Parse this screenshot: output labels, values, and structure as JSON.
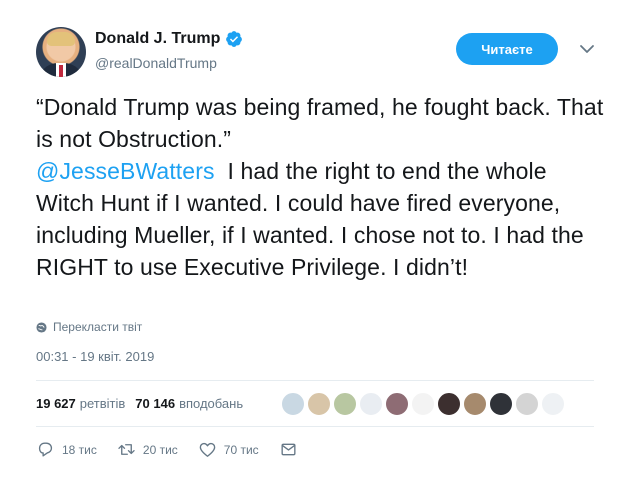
{
  "author": {
    "name": "Donald J. Trump",
    "handle": "@realDonaldTrump",
    "verified": true
  },
  "follow_button": {
    "label": "Читаєте",
    "color": "#1da1f2"
  },
  "tweet": {
    "line1": "“Donald Trump was being framed, he fought back. That is not Obstruction.”",
    "mention": "@JesseBWatters",
    "line2": "I had the right to end the whole Witch Hunt if I wanted. I could have fired everyone, including Mueller, if I wanted. I chose not to. I had the RIGHT to use Executive Privilege. I didn’t!"
  },
  "translate_label": "Перекласти твіт",
  "timestamp": "00:31 - 19 квіт. 2019",
  "stats": {
    "retweets_count": "19 627",
    "retweets_label": "ретвітів",
    "likes_count": "70 146",
    "likes_label": "вподобань"
  },
  "liker_avatars": [
    "#c9d8e3",
    "#d8c5a8",
    "#b8c7a1",
    "#e9edf2",
    "#8e6c74",
    "#f3f3f3",
    "#3c2f2f",
    "#a68a6d",
    "#2f3238",
    "#d4d4d4",
    "#eef1f4"
  ],
  "actions": {
    "replies": "18 тис",
    "retweets": "20 тис",
    "likes": "70 тис"
  },
  "colors": {
    "accent": "#1da1f2",
    "secondary_text": "#657786",
    "divider": "#e6ecf0"
  }
}
